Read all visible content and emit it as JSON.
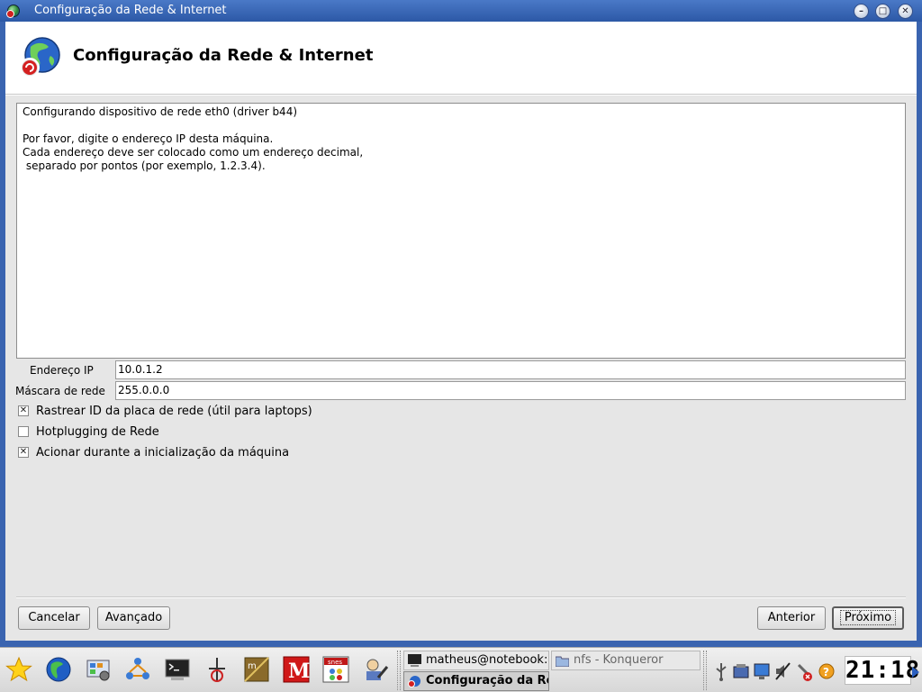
{
  "window": {
    "title": "Configuração da Rede & Internet",
    "buttons": {
      "minimize": "–",
      "maximize": "□",
      "close": "✕"
    }
  },
  "header": {
    "title": "Configuração da Rede & Internet",
    "icon": "network-globe-icon"
  },
  "info_text": "Configurando dispositivo de rede eth0 (driver b44)\n\nPor favor, digite o endereço IP desta máquina.\nCada endereço deve ser colocado como um endereço decimal,\n separado por pontos (por exemplo, 1.2.3.4).",
  "fields": {
    "ip": {
      "label": "Endereço IP",
      "value": "10.0.1.2"
    },
    "netmask": {
      "label": "Máscara de rede",
      "value": "255.0.0.0"
    }
  },
  "checkboxes": [
    {
      "label": "Rastrear ID da placa de rede (útil para laptops)",
      "checked": true
    },
    {
      "label": "Hotplugging de Rede",
      "checked": false
    },
    {
      "label": "Acionar durante a inicialização da máquina",
      "checked": true
    }
  ],
  "buttons": {
    "cancel": "Cancelar",
    "advanced": "Avançado",
    "back": "Anterior",
    "next": "Próximo"
  },
  "taskbar": {
    "launchers": [
      "star-icon",
      "globe-icon",
      "control-center-icon",
      "network-icon",
      "terminal-icon",
      "draw-icon",
      "package-manager-icon",
      "mail-icon",
      "snes-emulator-icon",
      "config-tool-icon"
    ],
    "snes_label": "snes",
    "tasks": [
      {
        "label": "matheus@notebook:",
        "icon": "terminal-icon"
      },
      {
        "label": "nfs - Konqueror",
        "icon": "folder-icon"
      },
      {
        "label": "Configuração da Re",
        "icon": "network-globe-icon"
      }
    ],
    "clock": "21:18"
  }
}
